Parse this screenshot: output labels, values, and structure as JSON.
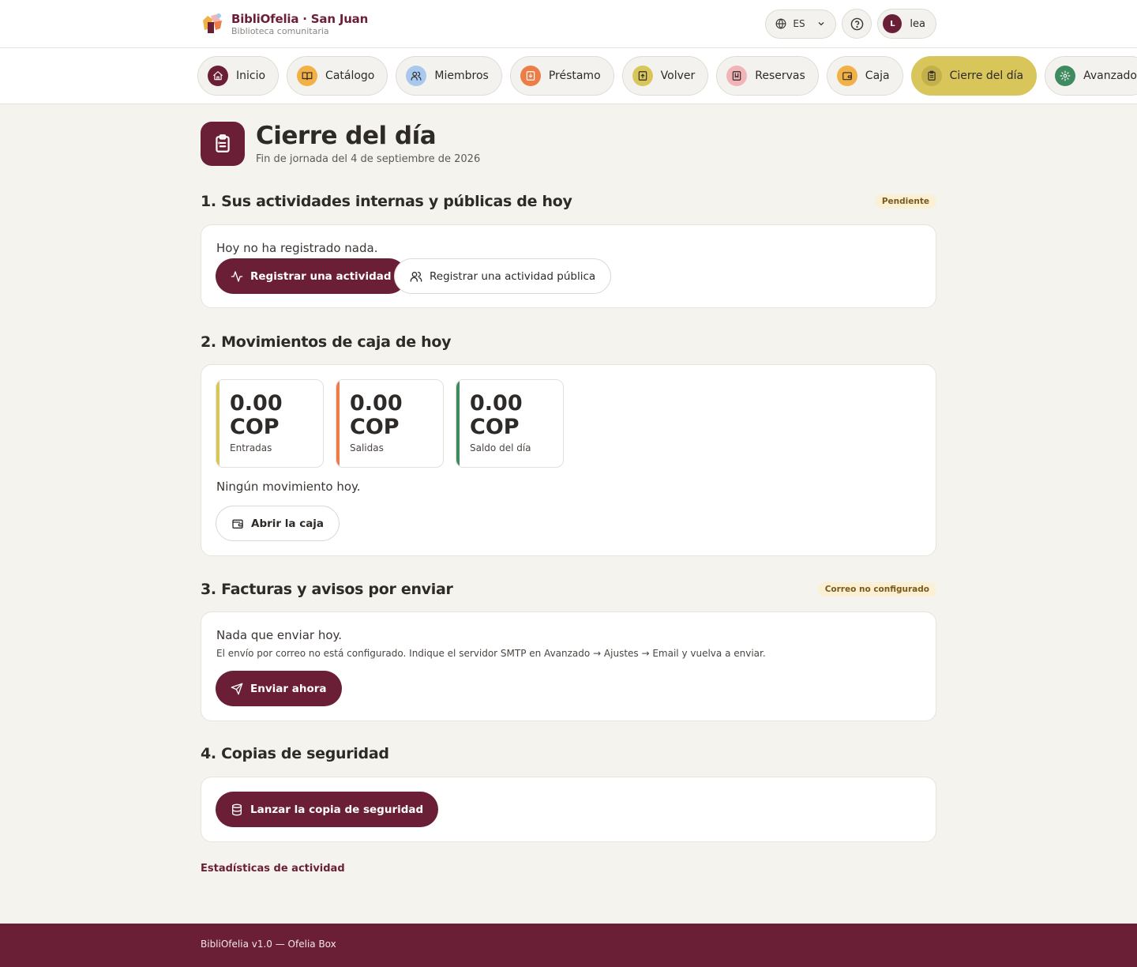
{
  "header": {
    "brand_name": "BibliOfelia · San Juan",
    "brand_subtitle": "Biblioteca comunitaria",
    "language": "ES",
    "user_initial": "L",
    "user_name": "lea"
  },
  "nav": {
    "items": [
      {
        "label": "Inicio",
        "icon": "home-icon",
        "color": "#6b1f37"
      },
      {
        "label": "Catálogo",
        "icon": "book-icon",
        "color": "#f2b146"
      },
      {
        "label": "Miembros",
        "icon": "users-icon",
        "color": "#a9c8ee"
      },
      {
        "label": "Préstamo",
        "icon": "loan-icon",
        "color": "#ec7d46"
      },
      {
        "label": "Volver",
        "icon": "return-icon",
        "color": "#d8c65a"
      },
      {
        "label": "Reservas",
        "icon": "bookmark-icon",
        "color": "#f2b5b7"
      },
      {
        "label": "Caja",
        "icon": "wallet-icon",
        "color": "#f2b146"
      },
      {
        "label": "Cierre del día",
        "icon": "clipboard-icon",
        "color": "#c2b04c",
        "active": true
      },
      {
        "label": "Avanzado",
        "icon": "gear-icon",
        "color": "#3f8a5e"
      }
    ]
  },
  "page": {
    "title": "Cierre del día",
    "subtitle": "Fin de jornada del 4 de septiembre de 2026"
  },
  "sections": {
    "activities": {
      "title": "1. Sus actividades internas y públicas de hoy",
      "badge": "Pendiente",
      "empty_text": "Hoy no ha registrado nada.",
      "btn_register": "Registrar una actividad",
      "btn_register_public": "Registrar una actividad pública"
    },
    "cash": {
      "title": "2. Movimientos de caja de hoy",
      "stats": [
        {
          "value": "0.00 COP",
          "label": "Entradas",
          "color": "#d8c65a"
        },
        {
          "value": "0.00 COP",
          "label": "Salidas",
          "color": "#ec7d46"
        },
        {
          "value": "0.00 COP",
          "label": "Saldo del día",
          "color": "#3f8a5e"
        }
      ],
      "empty_text": "Ningún movimiento hoy.",
      "btn_open": "Abrir la caja"
    },
    "invoices": {
      "title": "3. Facturas y avisos por enviar",
      "badge": "Correo no configurado",
      "empty_text": "Nada que enviar hoy.",
      "note": "El envío por correo no está configurado. Indique el servidor SMTP en Avanzado → Ajustes → Email y vuelva a enviar.",
      "btn_send": "Enviar ahora"
    },
    "backups": {
      "title": "4. Copias de seguridad",
      "btn_backup": "Lanzar la copia de seguridad"
    }
  },
  "stats_link": "Estadísticas de actividad",
  "footer": {
    "text": "BibliOfelia v1.0 — Ofelia Box"
  }
}
